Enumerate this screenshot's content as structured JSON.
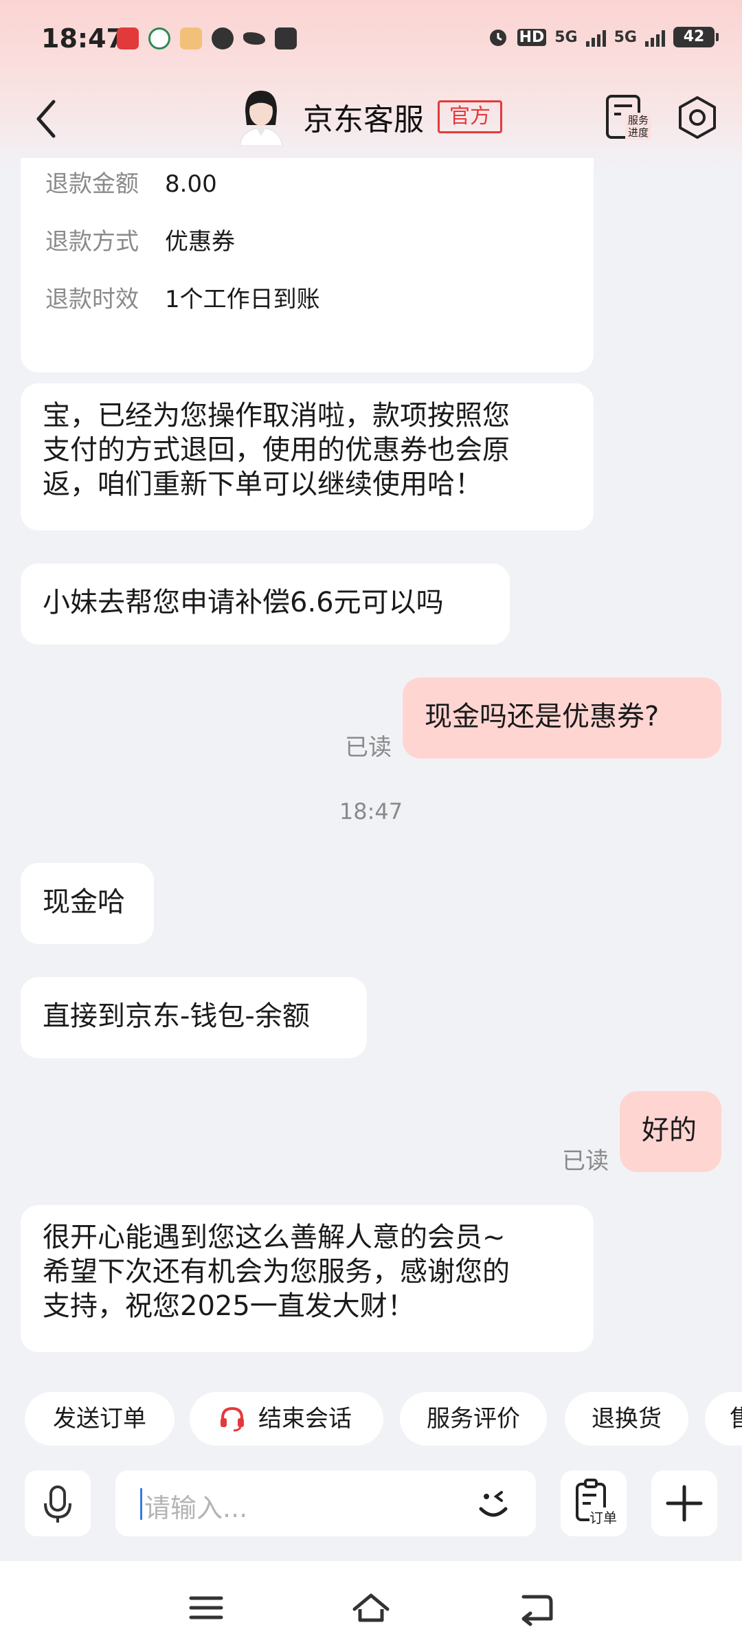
{
  "status_bar": {
    "time": "18:47",
    "hd_label": "HD",
    "net1": "5G",
    "net2": "5G",
    "battery": "42"
  },
  "header": {
    "agent_name": "京东客服",
    "badge": "官方",
    "progress_label_1": "服务",
    "progress_label_2": "进度"
  },
  "refund_card": {
    "rows": [
      {
        "key": "退款金额",
        "value": "8.00"
      },
      {
        "key": "退款方式",
        "value": "优惠券"
      },
      {
        "key": "退款时效",
        "value": "1个工作日到账"
      }
    ]
  },
  "messages": {
    "m1_lines": [
      "宝，已经为您操作取消啦，款项按照您",
      "支付的方式退回，使用的优惠券也会原",
      "返，咱们重新下单可以继续使用哈！"
    ],
    "m2": "小妹去帮您申请补偿6.6元可以吗",
    "m3": "现金吗还是优惠券?",
    "m3_status": "已读",
    "timestamp": "18:47",
    "m4": "现金哈",
    "m5": "直接到京东-钱包-余额",
    "m6": "好的",
    "m6_status": "已读",
    "m7_lines": [
      "很开心能遇到您这么善解人意的会员~",
      "希望下次还有机会为您服务，感谢您的",
      "支持，祝您2025一直发大财！"
    ]
  },
  "quick_actions": {
    "send_order": "发送订单",
    "end_session": "结束会话",
    "rate_service": "服务评价",
    "return_exchange": "退换货",
    "partial": "售"
  },
  "input_bar": {
    "placeholder": "请输入...",
    "order_label": "订单"
  },
  "colors": {
    "accent": "#e4393c",
    "my_bubble": "#ffd5d2",
    "background": "#f1f2f6"
  }
}
